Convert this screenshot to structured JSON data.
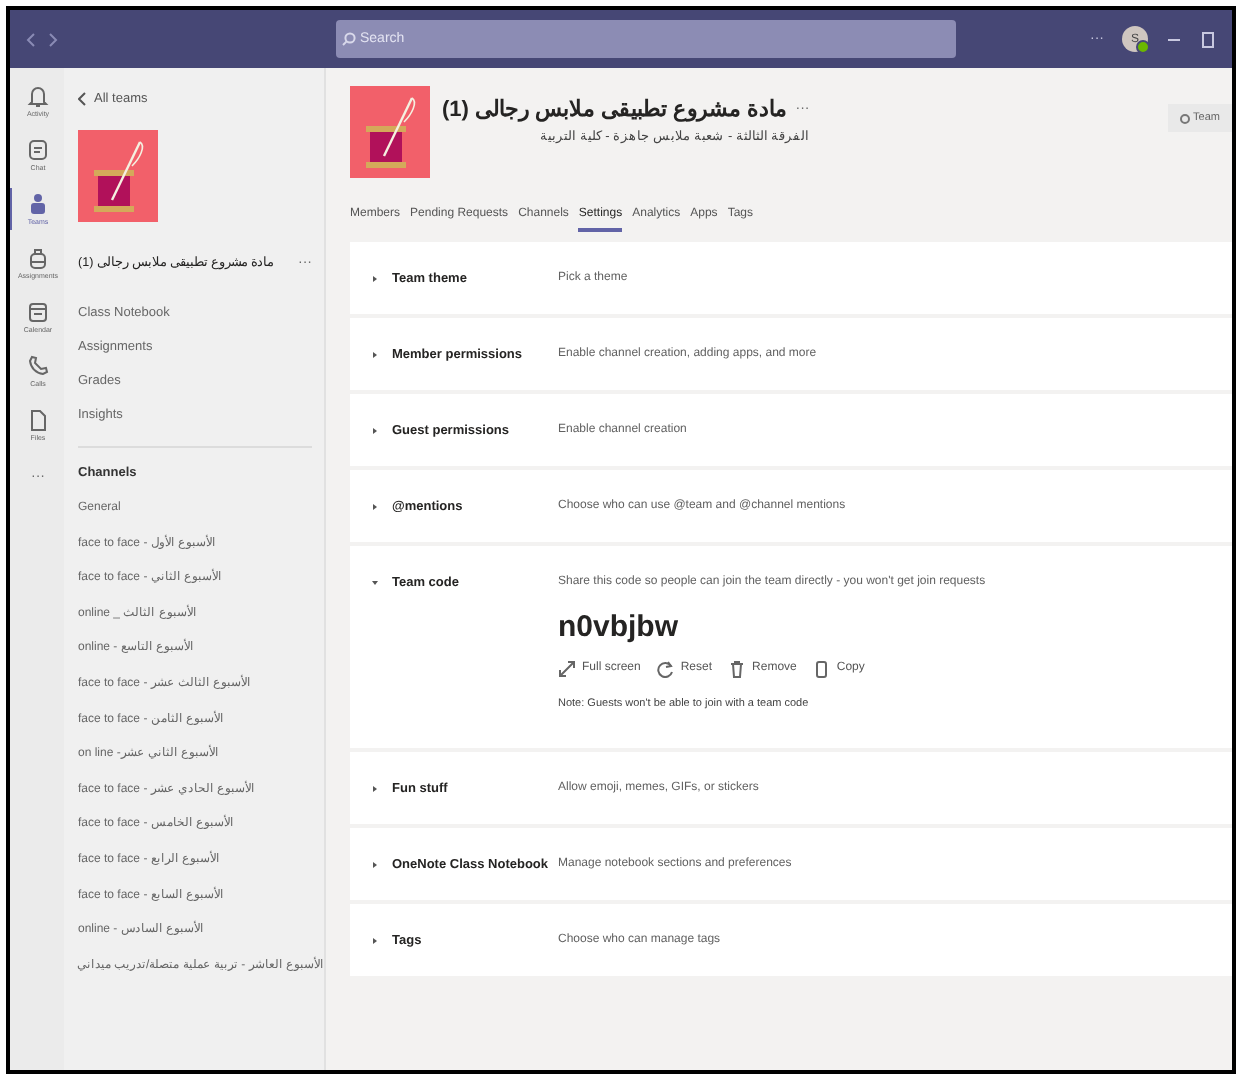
{
  "top_bar": {
    "search": {
      "placeholder": "Search"
    },
    "more": "···",
    "avatar": "S"
  },
  "rail": [
    {
      "label": "Activity",
      "kind": "bell",
      "selected": false
    },
    {
      "label": "Chat",
      "kind": "chat",
      "selected": false
    },
    {
      "label": "Teams",
      "kind": "teams",
      "selected": true
    },
    {
      "label": "Assignments",
      "kind": "bag",
      "selected": false
    },
    {
      "label": "Calendar",
      "kind": "calendar",
      "selected": false
    },
    {
      "label": "Calls",
      "kind": "phone",
      "selected": false
    },
    {
      "label": "Files",
      "kind": "file",
      "selected": false
    },
    {
      "label": "···",
      "kind": "more",
      "selected": false
    }
  ],
  "sidebar": {
    "back": "All teams",
    "team_name": "مادة مشروع تطبيقى ملابس رجالى (1)",
    "more": "···",
    "links": [
      "Class Notebook",
      "Assignments",
      "Grades",
      "Insights"
    ],
    "channels_heading": "Channels",
    "channels": [
      "General",
      "الأسبوع الأول - face to face",
      "الأسبوع الثاني - face to face",
      "الأسبوع الثالث _ online",
      "الأسبوع التاسع - online",
      "الأسبوع الثالث عشر - face to face",
      "الأسبوع الثامن - face to face",
      "الأسبوع الثاني عشر- on line",
      "الأسبوع الحادي عشر - face to face",
      "الأسبوع الخامس - face to face",
      "الأسبوع الرابع - face to face",
      "الأسبوع السابع - face to face",
      "الأسبوع السادس - online",
      "الأسبوع العاشر - تربية عملية متصلة/تدريب ميداني"
    ]
  },
  "header": {
    "title": "مادة مشروع تطبيقى ملابس رجالى (1)",
    "more": "···",
    "subtitle": "الفرقة الثالثة - شعبة ملابس جاهزة - كلية التربية",
    "team_button": "Team"
  },
  "tabs": [
    {
      "label": "Members",
      "selected": false
    },
    {
      "label": "Pending Requests",
      "selected": false
    },
    {
      "label": "Channels",
      "selected": false
    },
    {
      "label": "Settings",
      "selected": true
    },
    {
      "label": "Analytics",
      "selected": false
    },
    {
      "label": "Apps",
      "selected": false
    },
    {
      "label": "Tags",
      "selected": false
    }
  ],
  "settings": [
    {
      "title": "Team theme",
      "description": "Pick a theme",
      "expanded": false
    },
    {
      "title": "Member permissions",
      "description": "Enable channel creation, adding apps, and more",
      "expanded": false
    },
    {
      "title": "Guest permissions",
      "description": "Enable channel creation",
      "expanded": false
    },
    {
      "title": "@mentions",
      "description": "Choose who can use @team and @channel mentions",
      "expanded": false
    },
    {
      "title": "Team code",
      "description": "Share this code so people can join the team directly - you won't get join requests",
      "expanded": true,
      "code": "n0vbjbw",
      "actions": [
        {
          "label": "Full screen",
          "kind": "expand"
        },
        {
          "label": "Reset",
          "kind": "reset"
        },
        {
          "label": "Remove",
          "kind": "trash"
        },
        {
          "label": "Copy",
          "kind": "copy"
        }
      ],
      "note": "Note: Guests won't be able to join with a team code"
    },
    {
      "title": "Fun stuff",
      "description": "Allow emoji, memes, GIFs, or stickers",
      "expanded": false
    },
    {
      "title": "OneNote Class Notebook",
      "description": "Manage notebook sections and preferences",
      "expanded": false
    },
    {
      "title": "Tags",
      "description": "Choose who can manage tags",
      "expanded": false
    }
  ]
}
